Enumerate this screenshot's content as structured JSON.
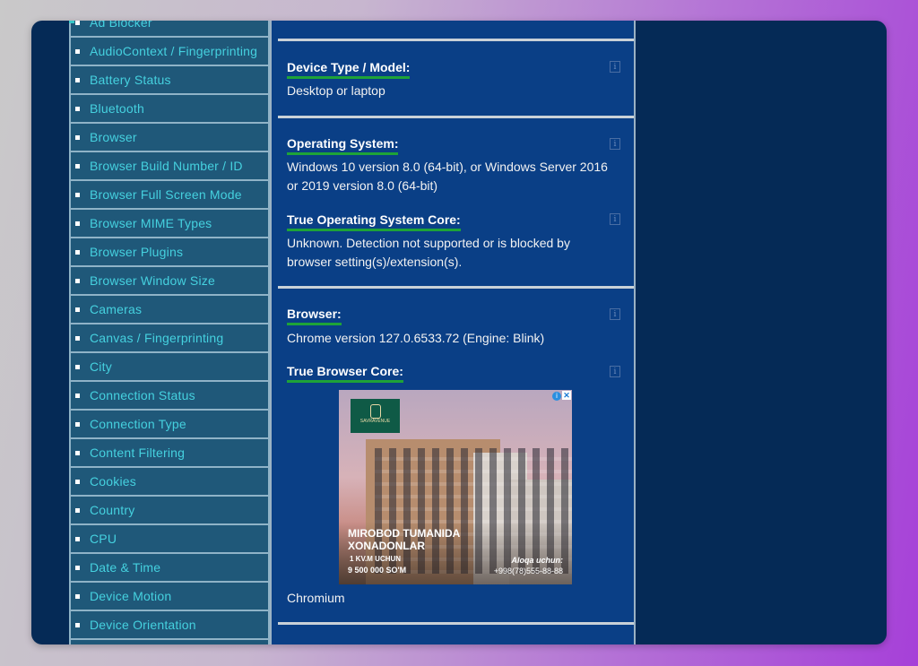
{
  "sidebar": {
    "items": [
      "Ad Blocker",
      "AudioContext / Fingerprinting",
      "Battery Status",
      "Bluetooth",
      "Browser",
      "Browser Build Number / ID",
      "Browser Full Screen Mode",
      "Browser MIME Types",
      "Browser Plugins",
      "Browser Window Size",
      "Cameras",
      "Canvas / Fingerprinting",
      "City",
      "Connection Status",
      "Connection Type",
      "Content Filtering",
      "Cookies",
      "Country",
      "CPU",
      "Date & Time",
      "Device Motion",
      "Device Orientation"
    ]
  },
  "sections": {
    "device_type": {
      "title": "Device Type / Model:",
      "value": "Desktop or laptop"
    },
    "os": {
      "title": "Operating System:",
      "value": "Windows 10 version 8.0 (64-bit), or Windows Server 2016 or 2019 version 8.0 (64-bit)"
    },
    "os_core": {
      "title": "True Operating System Core:",
      "value": "Unknown. Detection not supported or is blocked by browser setting(s)/extension(s)."
    },
    "browser": {
      "title": "Browser:",
      "value": "Chrome version 127.0.6533.72 (Engine: Blink)"
    },
    "browser_core": {
      "title": "True Browser Core:",
      "value": "Chromium"
    }
  },
  "info_icon_glyph": "i",
  "ad": {
    "brand": "SAVRAVENUE",
    "headline_1": "MIROBOD TUMANIDA",
    "headline_2": "XONADONLAR",
    "sub": "1 KV.M UCHUN",
    "price": "9 500 000 SO'M",
    "contact_label": "Aloqa uchun:",
    "phone": "+998(78)555-88-88",
    "adchoices_glyph": "i",
    "close_glyph": "✕"
  },
  "colors": {
    "window_bg": "#052a56",
    "sidebar_bg": "#1f5879",
    "sidebar_text": "#45d1df",
    "main_bg": "#0a3f86",
    "title_underline": "#1ea338"
  }
}
